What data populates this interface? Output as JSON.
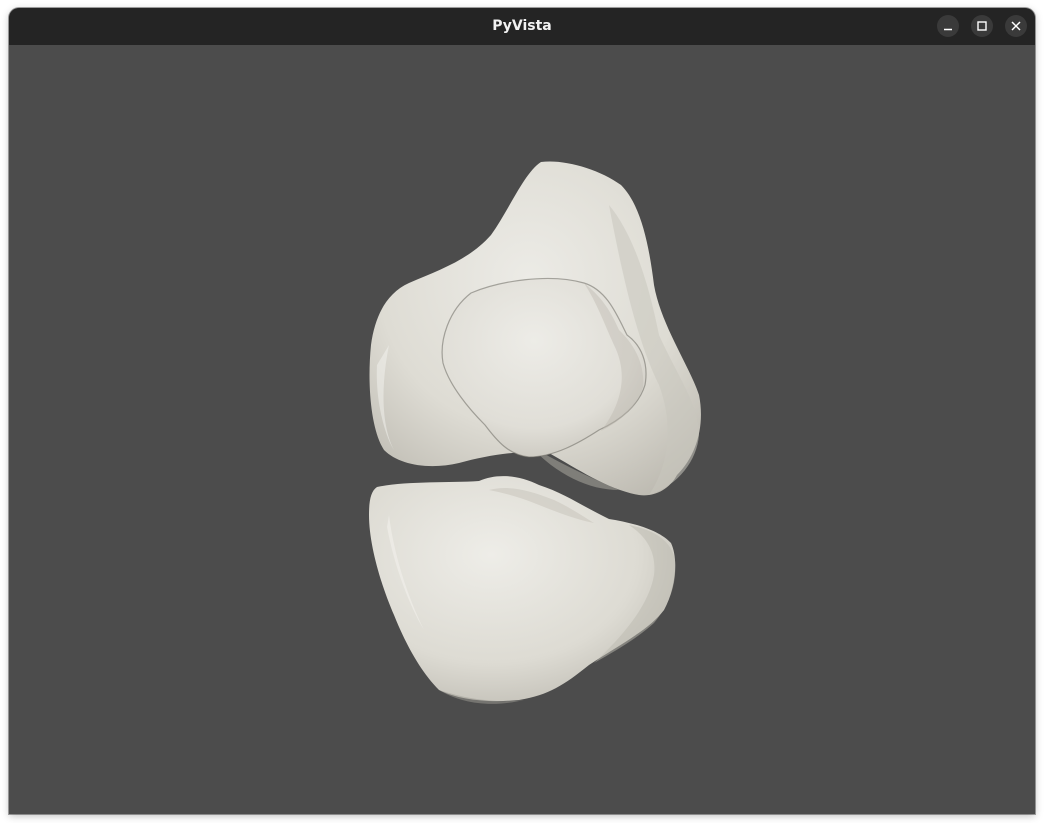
{
  "window": {
    "title": "PyVista",
    "controls": {
      "minimize_icon": "minimize-icon",
      "maximize_icon": "maximize-icon",
      "close_icon": "close-icon"
    }
  },
  "scene": {
    "background_color": "#4c4c4c",
    "mesh_color": "#ebe8e1",
    "objects": [
      "femur",
      "patella",
      "tibia"
    ]
  }
}
